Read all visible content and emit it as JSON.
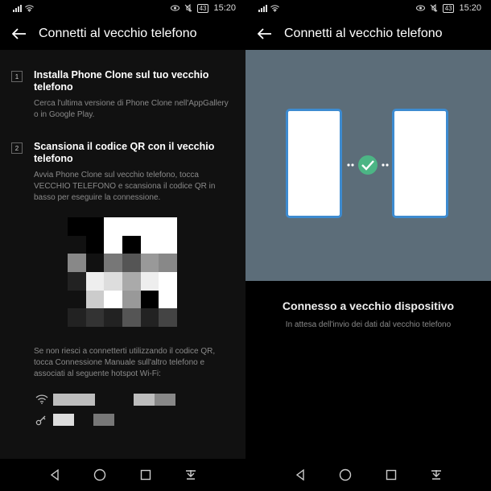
{
  "status_bar": {
    "time": "15:20",
    "battery": "43"
  },
  "left_screen": {
    "title": "Connetti al vecchio telefono",
    "steps": [
      {
        "number": "1",
        "title": "Installa Phone Clone sul tuo vecchio telefono",
        "description": "Cerca l'ultima versione di Phone Clone nell'AppGallery o in Google Play."
      },
      {
        "number": "2",
        "title": "Scansiona il codice QR con il vecchio telefono",
        "description": "Avvia Phone Clone sul vecchio telefono, tocca VECCHIO TELEFONO e scansiona il codice QR in basso per eseguire la connessione."
      }
    ],
    "manual_note": "Se non riesci a connetterti utilizzando il codice QR, tocca Connessione Manuale sull'altro telefono e associati al seguente hotspot Wi-Fi:",
    "wifi_icon": "wifi-icon",
    "key_icon": "key-icon"
  },
  "right_screen": {
    "title": "Connetti al vecchio telefono",
    "connected_title": "Connesso a vecchio dispositivo",
    "connected_subtitle": "In attesa dell'invio dei dati dal vecchio telefono"
  },
  "colors": {
    "accent_green": "#4cb585",
    "phone_border": "#3d8bd0",
    "illustration_bg": "#5c6d79"
  },
  "qr_pixelated_grays": [
    "#000",
    "#000",
    "#fff",
    "#fff",
    "#fff",
    "#fff",
    "#111",
    "#000",
    "#fff",
    "#000",
    "#fff",
    "#fff",
    "#888",
    "#111",
    "#777",
    "#555",
    "#999",
    "#888",
    "#222",
    "#eee",
    "#ddd",
    "#aaa",
    "#eee",
    "#fff",
    "#111",
    "#ccc",
    "#fff",
    "#999",
    "#000",
    "#fff",
    "#222",
    "#333",
    "#222",
    "#555",
    "#222",
    "#444"
  ]
}
